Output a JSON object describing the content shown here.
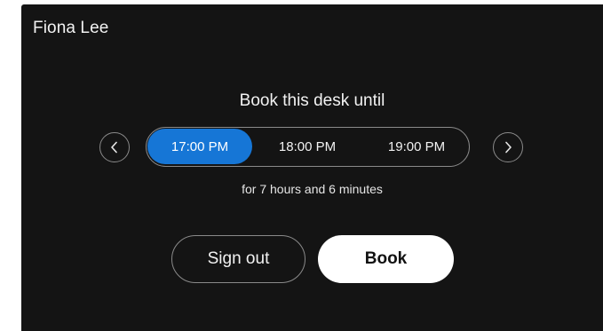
{
  "user": {
    "name": "Fiona Lee"
  },
  "booking": {
    "heading": "Book this desk until",
    "time_options": [
      {
        "label": "17:00 PM",
        "selected": true
      },
      {
        "label": "18:00 PM",
        "selected": false
      },
      {
        "label": "19:00 PM",
        "selected": false
      }
    ],
    "duration_text": "for 7 hours and 6 minutes"
  },
  "nav": {
    "prev_icon": "chevron-left-icon",
    "next_icon": "chevron-right-icon"
  },
  "actions": {
    "sign_out_label": "Sign out",
    "book_label": "Book"
  },
  "colors": {
    "background": "#141414",
    "accent": "#1676d6",
    "primary_button": "#ffffff",
    "outline": "#8a8a8a"
  }
}
